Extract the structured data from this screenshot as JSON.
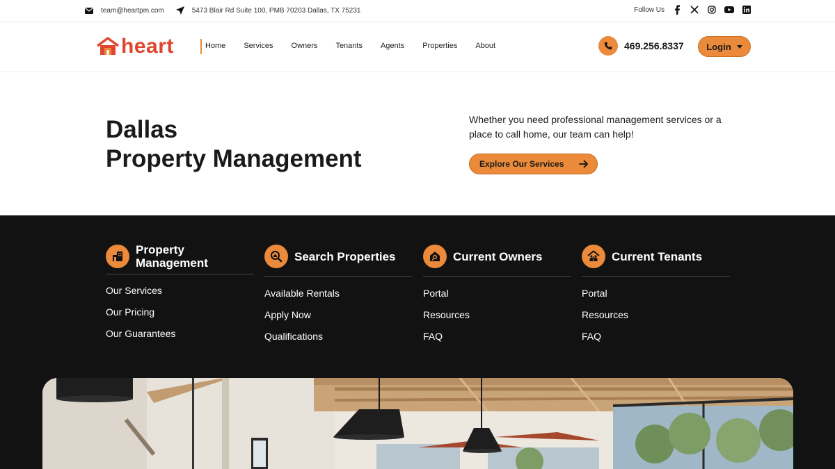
{
  "topbar": {
    "email": "team@heartpm.com",
    "address": "5473 Blair Rd Suite 100, PMB 70203 Dallas, TX 75231",
    "follow_label": "Follow Us",
    "socials": [
      "facebook-icon",
      "x-icon",
      "instagram-icon",
      "youtube-icon",
      "linkedin-icon"
    ]
  },
  "header": {
    "logo_text": "heart",
    "nav": [
      "Home",
      "Services",
      "Owners",
      "Tenants",
      "Agents",
      "Properties",
      "About"
    ],
    "phone": "469.256.8337",
    "login_label": "Login"
  },
  "hero": {
    "title_line1": "Dallas",
    "title_line2": "Property Management",
    "description": "Whether you need professional management services or a place to call home, our team can help!",
    "cta_label": "Explore Our Services"
  },
  "columns": [
    {
      "title": "Property Management",
      "icon": "building-icon",
      "links": [
        "Our Services",
        "Our Pricing",
        "Our Guarantees"
      ]
    },
    {
      "title": "Search Properties",
      "icon": "search-home-icon",
      "links": [
        "Available Rentals",
        "Apply Now",
        "Qualifications"
      ]
    },
    {
      "title": "Current Owners",
      "icon": "house-key-icon",
      "links": [
        "Portal",
        "Resources",
        "FAQ"
      ]
    },
    {
      "title": "Current Tenants",
      "icon": "family-home-icon",
      "links": [
        "Portal",
        "Resources",
        "FAQ"
      ]
    }
  ],
  "colors": {
    "accent": "#ea8a3a",
    "brand_red": "#e0452f",
    "dark_bg": "#121212"
  }
}
